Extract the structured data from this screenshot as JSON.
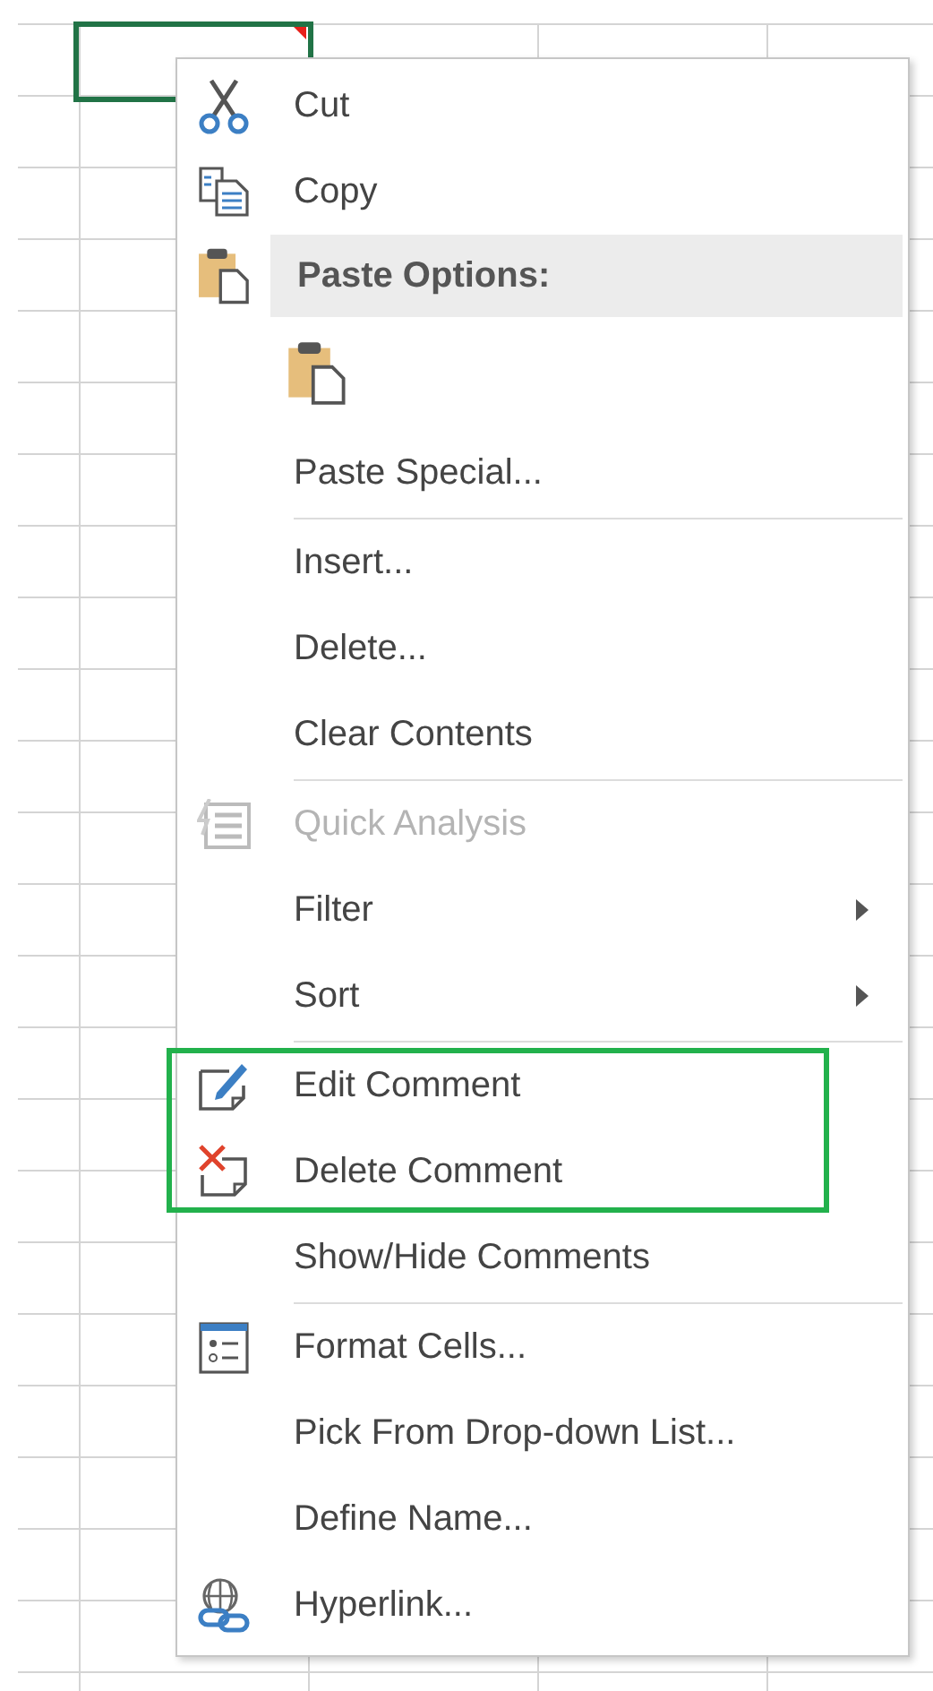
{
  "sheet": {
    "selected_cell": {
      "has_comment": true
    }
  },
  "context_menu": {
    "entries": [
      {
        "kind": "item",
        "label": "Cut",
        "disabled": false,
        "submenu": false
      },
      {
        "kind": "item",
        "label": "Copy",
        "disabled": false,
        "submenu": false
      },
      {
        "kind": "header",
        "label": "Paste Options:"
      },
      {
        "kind": "paste-options"
      },
      {
        "kind": "item",
        "label": "Paste Special...",
        "disabled": false,
        "submenu": false
      },
      {
        "kind": "separator"
      },
      {
        "kind": "item",
        "label": "Insert...",
        "disabled": false,
        "submenu": false
      },
      {
        "kind": "item",
        "label": "Delete...",
        "disabled": false,
        "submenu": false
      },
      {
        "kind": "item",
        "label": "Clear Contents",
        "disabled": false,
        "submenu": false
      },
      {
        "kind": "separator"
      },
      {
        "kind": "item",
        "label": "Quick Analysis",
        "disabled": true,
        "submenu": false
      },
      {
        "kind": "item",
        "label": "Filter",
        "disabled": false,
        "submenu": true
      },
      {
        "kind": "item",
        "label": "Sort",
        "disabled": false,
        "submenu": true
      },
      {
        "kind": "separator"
      },
      {
        "kind": "outlined-group",
        "children": [
          {
            "kind": "item",
            "label": "Edit Comment",
            "disabled": false,
            "submenu": false
          },
          {
            "kind": "item",
            "label": "Delete Comment",
            "disabled": false,
            "submenu": false
          }
        ]
      },
      {
        "kind": "item",
        "label": "Show/Hide Comments",
        "disabled": false,
        "submenu": false
      },
      {
        "kind": "separator"
      },
      {
        "kind": "item",
        "label": "Format Cells...",
        "disabled": false,
        "submenu": false
      },
      {
        "kind": "item",
        "label": "Pick From Drop-down List...",
        "disabled": false,
        "submenu": false
      },
      {
        "kind": "item",
        "label": "Define Name...",
        "disabled": false,
        "submenu": false
      },
      {
        "kind": "item",
        "label": "Hyperlink...",
        "disabled": false,
        "submenu": false
      }
    ]
  }
}
